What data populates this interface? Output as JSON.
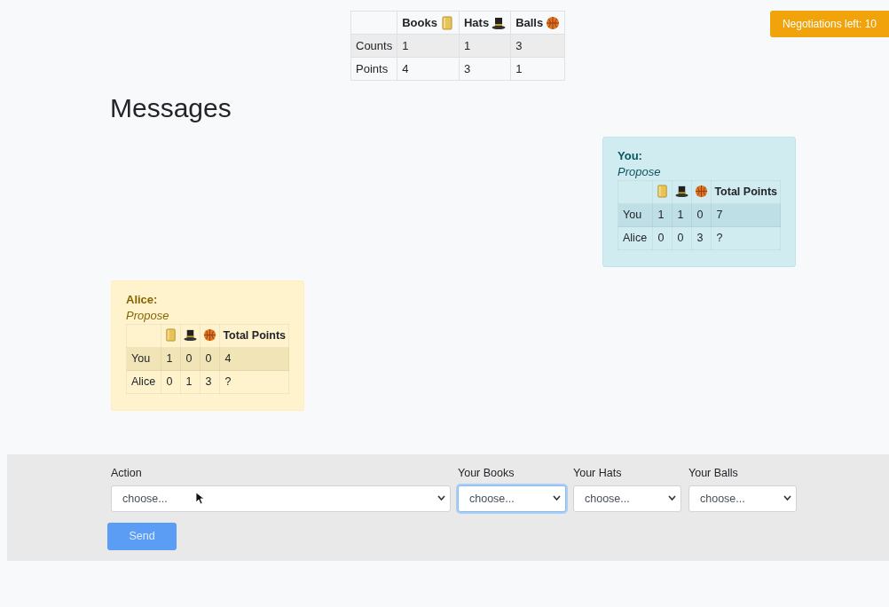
{
  "summary_table": {
    "columns": [
      {
        "label": "Books"
      },
      {
        "label": "Hats"
      },
      {
        "label": "Balls"
      }
    ],
    "rows": [
      {
        "label": "Counts",
        "cells": [
          "1",
          "1",
          "3"
        ]
      },
      {
        "label": "Points",
        "cells": [
          "4",
          "3",
          "1"
        ]
      }
    ]
  },
  "badge": "Negotiations left: 10",
  "heading": "Messages",
  "messages": [
    {
      "kind": "own",
      "sender": "You:",
      "action": "Propose",
      "total_header": "Total Points",
      "rows": [
        {
          "label": "You",
          "cells": [
            "1",
            "1",
            "0",
            "7"
          ]
        },
        {
          "label": "Alice",
          "cells": [
            "0",
            "0",
            "3",
            "?"
          ]
        }
      ]
    },
    {
      "kind": "other",
      "sender": "Alice:",
      "action": "Propose",
      "total_header": "Total Points",
      "rows": [
        {
          "label": "You",
          "cells": [
            "1",
            "0",
            "0",
            "4"
          ]
        },
        {
          "label": "Alice",
          "cells": [
            "0",
            "1",
            "3",
            "?"
          ]
        }
      ]
    }
  ],
  "form": {
    "fields": [
      {
        "label": "Action",
        "value": "choose...",
        "focused": false
      },
      {
        "label": "Your Books",
        "value": "choose...",
        "focused": true
      },
      {
        "label": "Your Hats",
        "value": "choose...",
        "focused": false
      },
      {
        "label": "Your Balls",
        "value": "choose...",
        "focused": false
      }
    ],
    "button": {
      "label": "Send",
      "disabled": true
    }
  }
}
